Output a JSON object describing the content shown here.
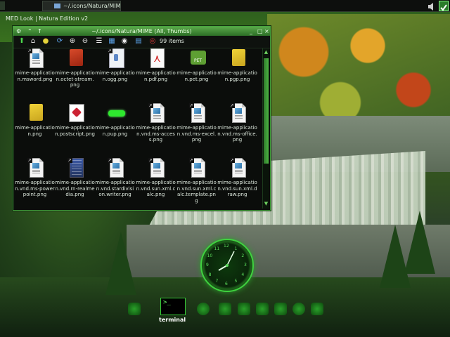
{
  "top_panel": {
    "task_title": "~/.icons/Natura/MIM"
  },
  "desktop": {
    "label": "MED Look | Natura Edition v2"
  },
  "window": {
    "title": "~/.icons/Natura/MIME (All, Thumbs)",
    "title_buttons": [
      "⚙",
      "↑",
      "↑",
      "_",
      "□",
      "×"
    ],
    "items_count": "99 items",
    "accent": "#46a43f"
  },
  "files": [
    {
      "label": "mime-application.msword.png",
      "icon": "doc-icon"
    },
    {
      "label": "mime-application.octet-stream.png",
      "icon": "red-note-icon"
    },
    {
      "label": "mime-application.ogg.png",
      "icon": "audio-icon"
    },
    {
      "label": "mime-application.pdf.png",
      "icon": "pdf-icon"
    },
    {
      "label": "mime-application.pet.png",
      "icon": "pet-icon"
    },
    {
      "label": "mime-application.pgp.png",
      "icon": "yellow-note-icon"
    },
    {
      "label": "mime-application.png",
      "icon": "yellow-note-icon"
    },
    {
      "label": "mime-application.postscript.png",
      "icon": "postscript-icon"
    },
    {
      "label": "mime-application.pup.png",
      "icon": "bone-icon"
    },
    {
      "label": "mime-application.vnd.ms-access.png",
      "icon": "doc-icon"
    },
    {
      "label": "mime-application.vnd.ms-excel.png",
      "icon": "doc-icon"
    },
    {
      "label": "mime-application.vnd.ms-office.png",
      "icon": "doc-icon"
    },
    {
      "label": "mime-application.vnd.ms-powerpoint.png",
      "icon": "doc-icon"
    },
    {
      "label": "mime-application.vnd.rn-realmedia.png",
      "icon": "media-icon"
    },
    {
      "label": "mime-application.vnd.stardivision.writer.png",
      "icon": "doc-icon"
    },
    {
      "label": "mime-application.vnd.sun.xml.calc.png",
      "icon": "doc-icon"
    },
    {
      "label": "mime-application.vnd.sun.xml.calc.template.png",
      "icon": "doc-icon"
    },
    {
      "label": "mime-application.vnd.sun.xml.draw.png",
      "icon": "doc-icon"
    }
  ],
  "clock": {
    "numerals": [
      "12",
      "1",
      "2",
      "3",
      "4",
      "5",
      "6",
      "7",
      "8",
      "9",
      "10",
      "11"
    ]
  },
  "dock": {
    "terminal_label": "terminal",
    "terminal_glyph": ">_"
  },
  "colors": {
    "accent_green": "#3fd23f"
  }
}
